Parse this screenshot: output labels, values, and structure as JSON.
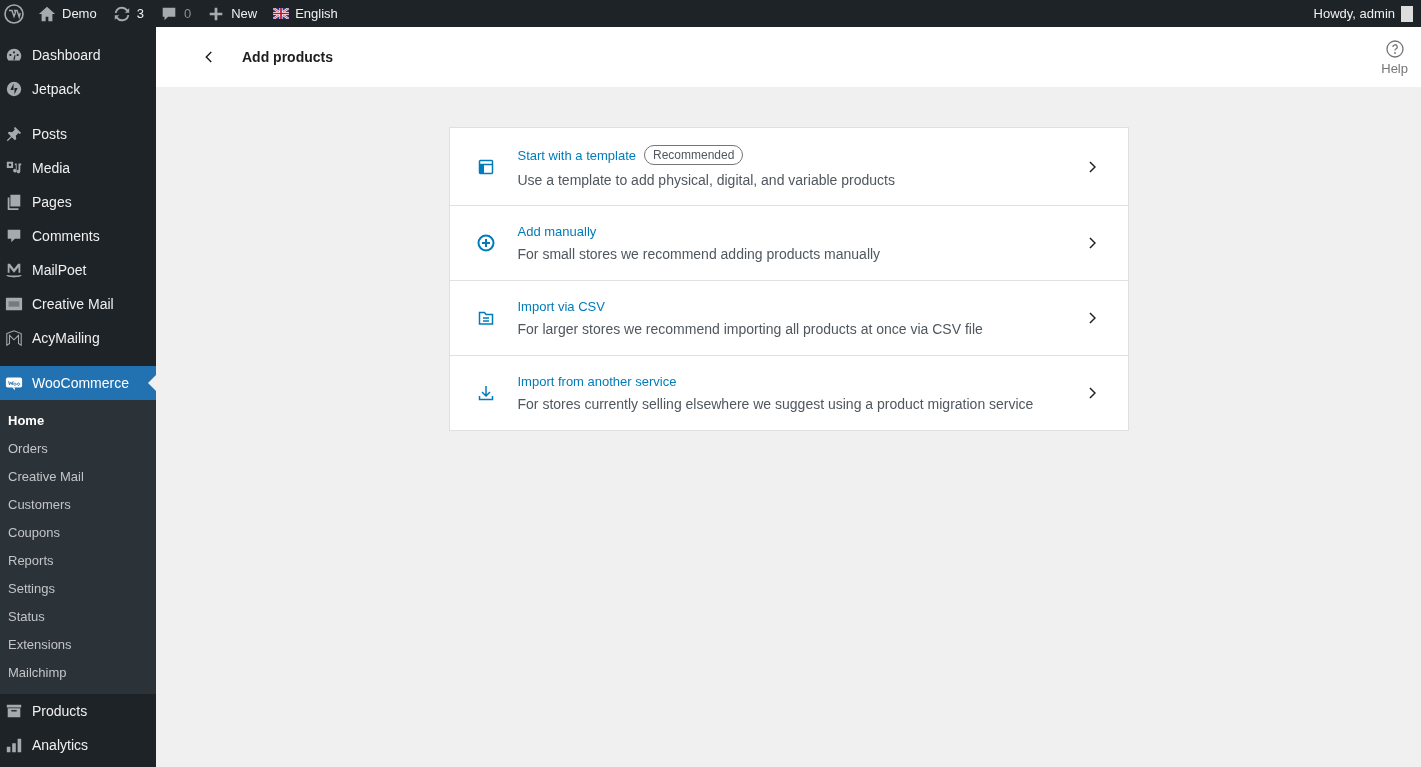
{
  "admin_bar": {
    "site": "Demo",
    "updates": "3",
    "comments": "0",
    "new": "New",
    "language": "English",
    "greeting": "Howdy, admin"
  },
  "sidebar": {
    "items": [
      {
        "label": "Dashboard",
        "selected": false
      },
      {
        "label": "Jetpack",
        "selected": false
      },
      {
        "label": "Posts",
        "selected": false
      },
      {
        "label": "Media",
        "selected": false
      },
      {
        "label": "Pages",
        "selected": false
      },
      {
        "label": "Comments",
        "selected": false
      },
      {
        "label": "MailPoet",
        "selected": false
      },
      {
        "label": "Creative Mail",
        "selected": false
      },
      {
        "label": "AcyMailing",
        "selected": false
      },
      {
        "label": "WooCommerce",
        "selected": true,
        "children": [
          {
            "label": "Home",
            "selected": true
          },
          {
            "label": "Orders",
            "selected": false
          },
          {
            "label": "Creative Mail",
            "selected": false
          },
          {
            "label": "Customers",
            "selected": false
          },
          {
            "label": "Coupons",
            "selected": false
          },
          {
            "label": "Reports",
            "selected": false
          },
          {
            "label": "Settings",
            "selected": false
          },
          {
            "label": "Status",
            "selected": false
          },
          {
            "label": "Extensions",
            "selected": false
          },
          {
            "label": "Mailchimp",
            "selected": false
          }
        ]
      },
      {
        "label": "Products",
        "selected": false
      },
      {
        "label": "Analytics",
        "selected": false
      }
    ]
  },
  "header": {
    "title": "Add products",
    "help": "Help"
  },
  "options": [
    {
      "title": "Start with a template",
      "badge": "Recommended",
      "description": "Use a template to add physical, digital, and variable products"
    },
    {
      "title": "Add manually",
      "description": "For small stores we recommend adding products manually"
    },
    {
      "title": "Import via CSV",
      "description": "For larger stores we recommend importing all products at once via CSV file"
    },
    {
      "title": "Import from another service",
      "description": "For stores currently selling elsewhere we suggest using a product migration service"
    }
  ]
}
